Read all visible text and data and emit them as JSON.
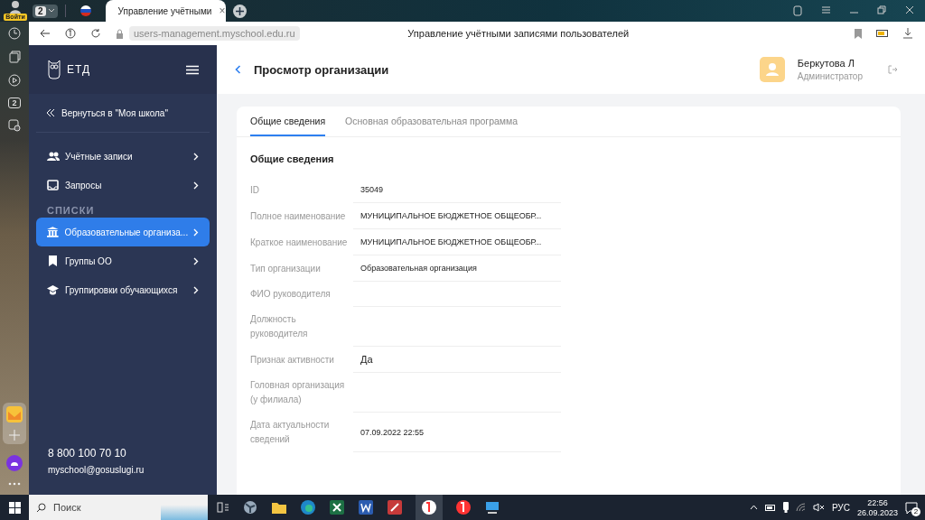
{
  "browser": {
    "profile_badge": "Войти",
    "tab_count": "2",
    "tabs": [
      {
        "kind": "pinned",
        "selected": false
      },
      {
        "kind": "page",
        "title": "Управление учётными",
        "close": "×",
        "selected": true
      }
    ],
    "url": "users-management.myschool.edu.ru",
    "page_title": "Управление учётными записями пользователей"
  },
  "side_panel": {
    "counter": "2"
  },
  "sidebar": {
    "logo": "ЕТД",
    "back_link": "Вернуться в \"Моя школа\"",
    "items": [
      {
        "kind": "item",
        "label": "Учётные записи",
        "selected": false
      },
      {
        "kind": "item",
        "label": "Запросы",
        "selected": false
      },
      {
        "kind": "section",
        "label": "СПИСКИ"
      },
      {
        "kind": "item",
        "label": "Образовательные организа...",
        "selected": true
      },
      {
        "kind": "item",
        "label": "Группы ОО",
        "selected": false
      },
      {
        "kind": "item",
        "label": "Группировки обучающихся",
        "selected": false
      }
    ],
    "phone": "8 800 100 70 10",
    "email": "myschool@gosuslugi.ru"
  },
  "header": {
    "title": "Просмотр организации",
    "user_name": "Беркутова Л",
    "user_role": "Администратор"
  },
  "tabs": [
    {
      "label": "Общие сведения",
      "selected": true
    },
    {
      "label": "Основная образовательная программа",
      "selected": false
    }
  ],
  "section_title": "Общие сведения",
  "fields": [
    {
      "label": "ID",
      "value": "35049"
    },
    {
      "label": "Полное наименование",
      "value": "МУНИЦИПАЛЬНОЕ БЮДЖЕТНОЕ ОБЩЕОБР..."
    },
    {
      "label": "Краткое наименование",
      "value": "МУНИЦИПАЛЬНОЕ БЮДЖЕТНОЕ ОБЩЕОБР..."
    },
    {
      "label": "Тип организации",
      "value": "Образовательная организация"
    },
    {
      "label": "ФИО руководителя"
    },
    {
      "label": "Должность руководителя"
    },
    {
      "label": "Признак активности",
      "value": "Да"
    },
    {
      "label": "Головная организация (у филиала)"
    },
    {
      "label": "Дата актуальности сведений",
      "value": "07.09.2022 22:55"
    }
  ],
  "taskbar": {
    "search_placeholder": "Поиск",
    "language": "РУС",
    "time": "22:56",
    "date": "26.09.2023",
    "notifications": "2"
  }
}
